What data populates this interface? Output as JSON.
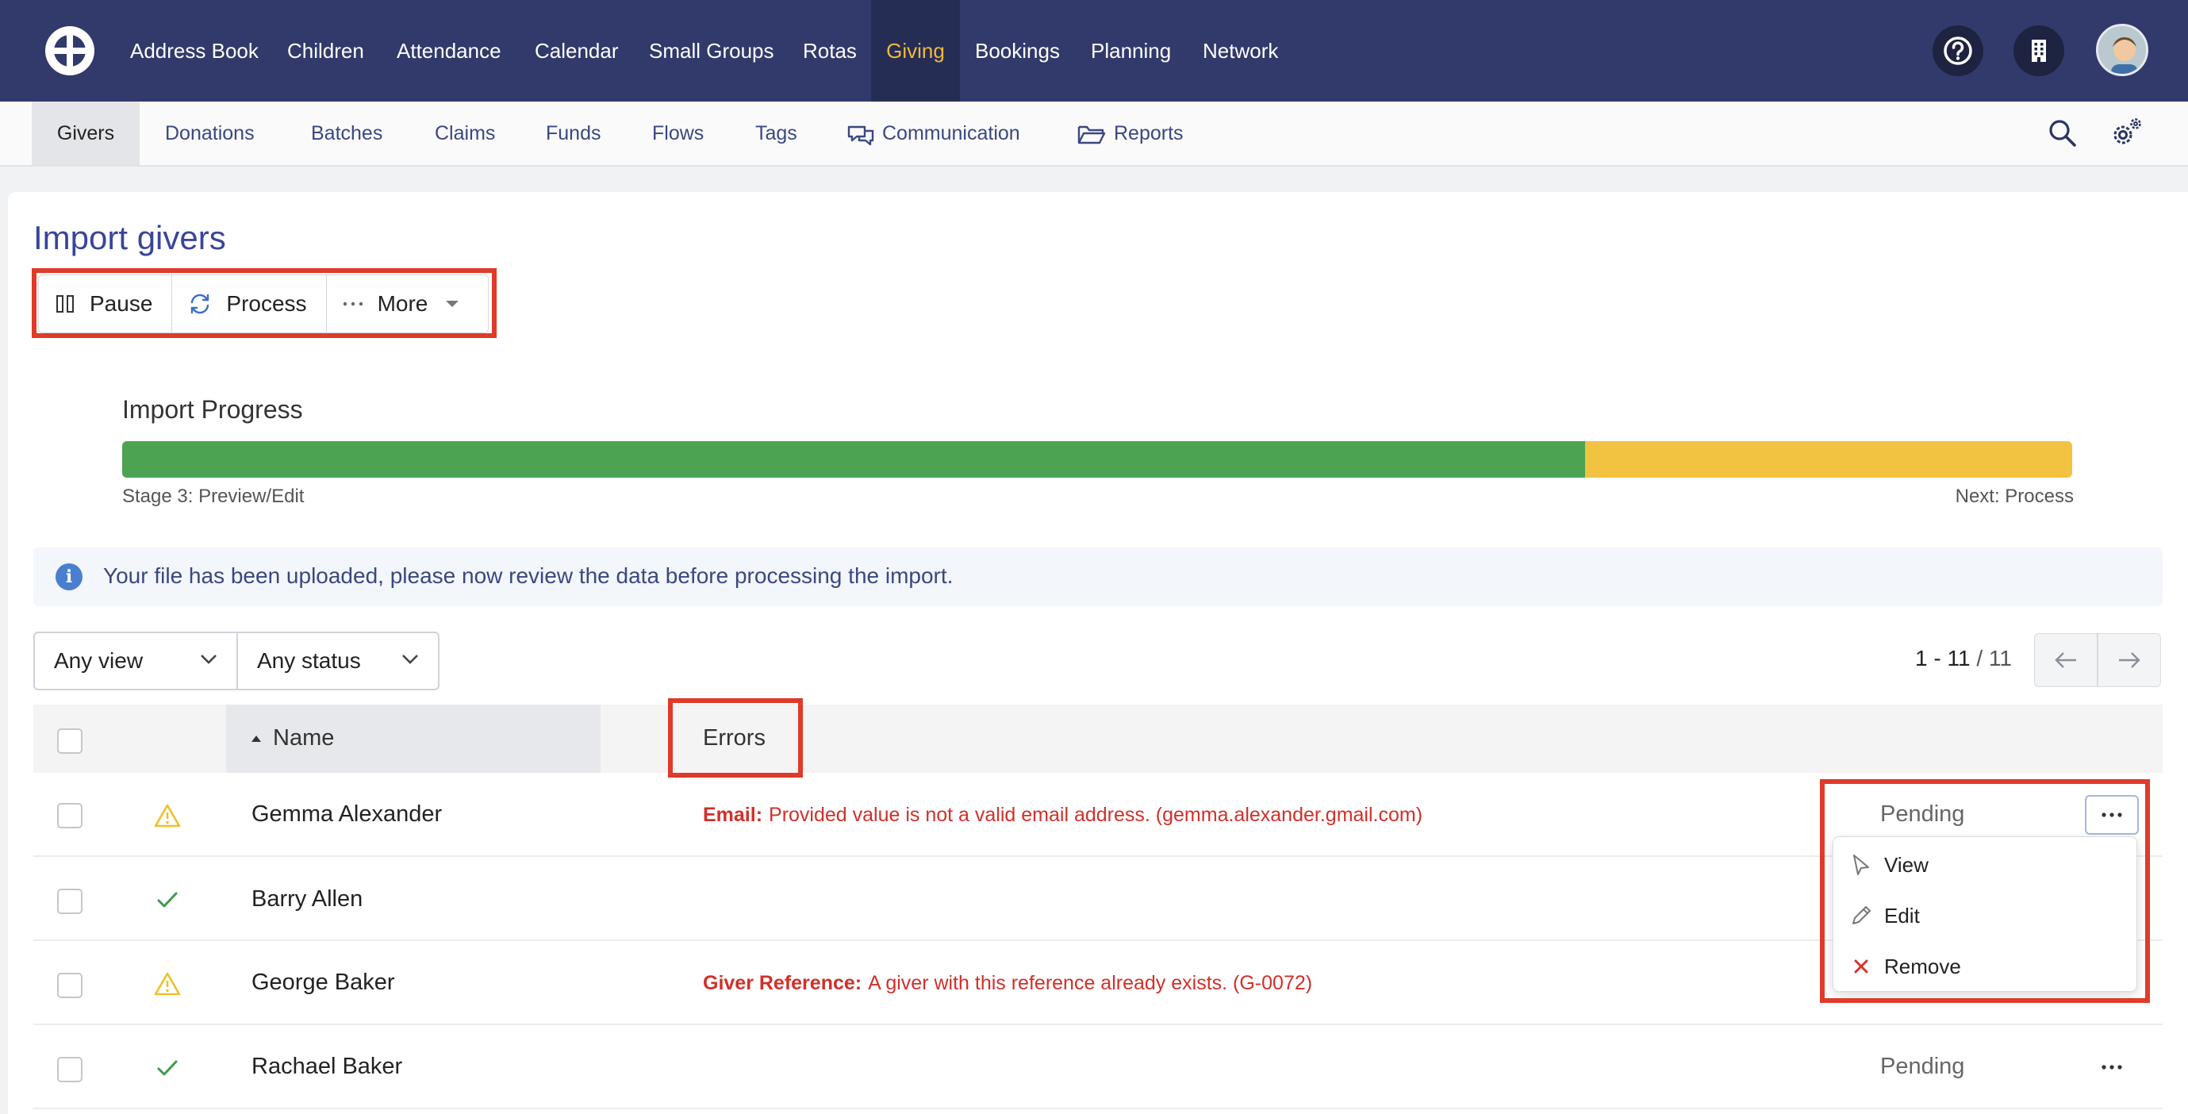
{
  "top_nav": {
    "items": [
      {
        "label": "Address Book"
      },
      {
        "label": "Children"
      },
      {
        "label": "Attendance"
      },
      {
        "label": "Calendar"
      },
      {
        "label": "Small Groups"
      },
      {
        "label": "Rotas"
      },
      {
        "label": "Giving",
        "active": true
      },
      {
        "label": "Bookings"
      },
      {
        "label": "Planning"
      },
      {
        "label": "Network"
      }
    ],
    "icons": [
      "help-icon",
      "building-icon"
    ],
    "colors": {
      "background": "#313a6b",
      "active_text": "#f0b93a"
    }
  },
  "sub_nav": {
    "items": [
      {
        "label": "Givers",
        "active": true
      },
      {
        "label": "Donations"
      },
      {
        "label": "Batches"
      },
      {
        "label": "Claims"
      },
      {
        "label": "Funds"
      },
      {
        "label": "Flows"
      },
      {
        "label": "Tags"
      },
      {
        "label": "Communication",
        "icon": "chat-icon"
      },
      {
        "label": "Reports",
        "icon": "folder-icon"
      }
    ],
    "right_icons": [
      "search-icon",
      "settings-icon"
    ]
  },
  "page": {
    "title": "Import givers"
  },
  "toolbar": {
    "pause_label": "Pause",
    "process_label": "Process",
    "more_label": "More"
  },
  "progress": {
    "label": "Import Progress",
    "complete_fraction": 0.75,
    "stage_text": "Stage 3: Preview/Edit",
    "next_text": "Next: Process",
    "colors": {
      "done": "#4ca352",
      "remaining": "#f2c241"
    }
  },
  "alert": {
    "text": "Your file has been uploaded, please now review the data before processing the import."
  },
  "filters": {
    "view_value": "Any view",
    "status_value": "Any status"
  },
  "pagination": {
    "range": "1 - 11",
    "total": "/ 11"
  },
  "table": {
    "headers": {
      "name": "Name",
      "errors": "Errors"
    },
    "rows": [
      {
        "name": "Gemma Alexander",
        "status_icon": "warning-icon",
        "error_field": "Email:",
        "error_message": "Provided value is not a valid email address. (gemma.alexander.gmail.com)",
        "status": "Pending"
      },
      {
        "name": "Barry Allen",
        "status_icon": "check-icon",
        "error_field": "",
        "error_message": "",
        "status": ""
      },
      {
        "name": "George Baker",
        "status_icon": "warning-icon",
        "error_field": "Giver Reference:",
        "error_message": "A giver with this reference already exists. (G-0072)",
        "status": ""
      },
      {
        "name": "Rachael Baker",
        "status_icon": "check-icon",
        "error_field": "",
        "error_message": "",
        "status": "Pending"
      }
    ]
  },
  "row_menu": {
    "view_label": "View",
    "edit_label": "Edit",
    "remove_label": "Remove"
  }
}
